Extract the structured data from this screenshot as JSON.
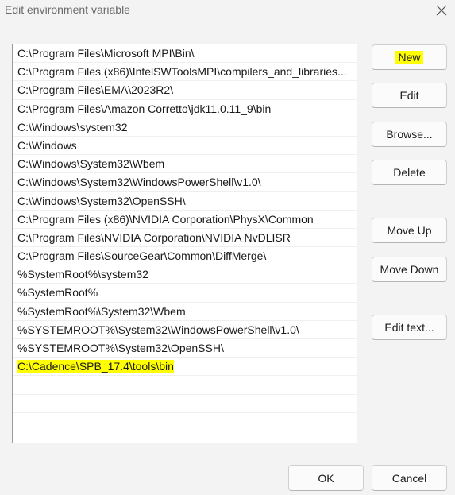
{
  "dialog": {
    "title": "Edit environment variable",
    "close_icon": "close-icon"
  },
  "paths": [
    "C:\\Program Files\\Microsoft MPI\\Bin\\",
    "C:\\Program Files (x86)\\IntelSWToolsMPI\\compilers_and_libraries...",
    "C:\\Program Files\\EMA\\2023R2\\",
    "C:\\Program Files\\Amazon Corretto\\jdk11.0.11_9\\bin",
    "C:\\Windows\\system32",
    "C:\\Windows",
    "C:\\Windows\\System32\\Wbem",
    "C:\\Windows\\System32\\WindowsPowerShell\\v1.0\\",
    "C:\\Windows\\System32\\OpenSSH\\",
    "C:\\Program Files (x86)\\NVIDIA Corporation\\PhysX\\Common",
    "C:\\Program Files\\NVIDIA Corporation\\NVIDIA NvDLISR",
    "C:\\Program Files\\SourceGear\\Common\\DiffMerge\\",
    "%SystemRoot%\\system32",
    "%SystemRoot%",
    "%SystemRoot%\\System32\\Wbem",
    "%SYSTEMROOT%\\System32\\WindowsPowerShell\\v1.0\\",
    "%SYSTEMROOT%\\System32\\OpenSSH\\",
    "C:\\Cadence\\SPB_17.4\\tools\\bin"
  ],
  "highlight_color": "#ffff00",
  "buttons": {
    "new": "New",
    "edit": "Edit",
    "browse": "Browse...",
    "delete": "Delete",
    "move_up": "Move Up",
    "move_down": "Move Down",
    "edit_text": "Edit text...",
    "ok": "OK",
    "cancel": "Cancel"
  }
}
